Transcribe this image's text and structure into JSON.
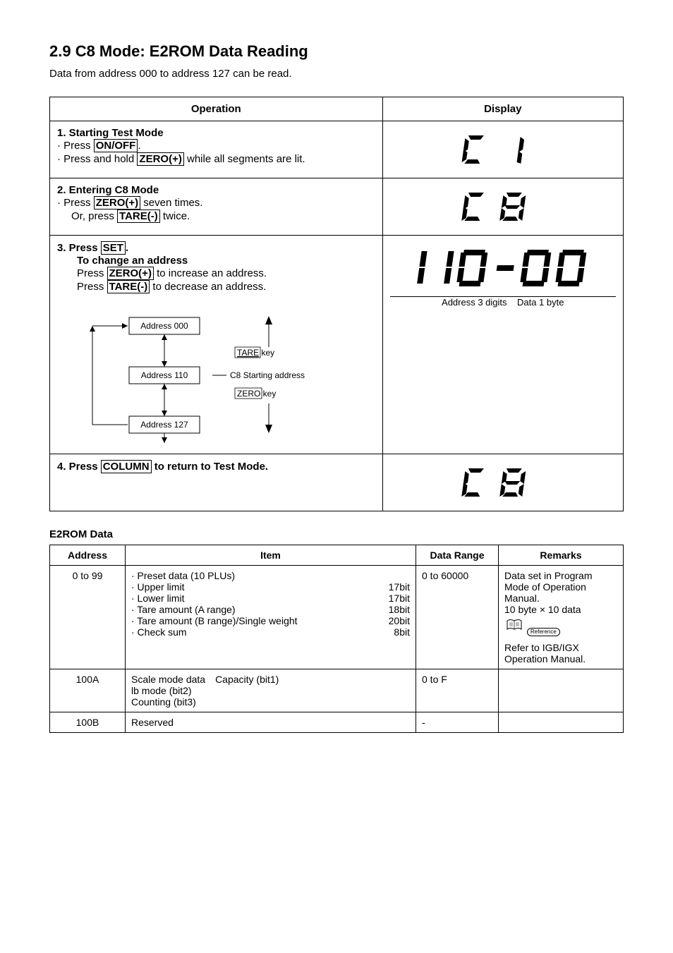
{
  "heading": "2.9   C8 Mode: E2ROM Data Reading",
  "intro": "Data from address 000 to address 127 can be read.",
  "table1": {
    "headers": {
      "operation": "Operation",
      "display": "Display"
    },
    "row1": {
      "title": "1.  Starting Test Mode",
      "line1a": "· Press ",
      "btn1": "ON/OFF",
      "line1b": ".",
      "line2a": "· Press and hold ",
      "btn2": "ZERO(+)",
      "line2b": " while all segments are lit.",
      "display_seg": "C1"
    },
    "row2": {
      "title": "2.  Entering C8 Mode",
      "line1a": "· Press ",
      "btn1": "ZERO(+)",
      "line1b": " seven times.",
      "line2a": "Or, press ",
      "btn2": "TARE(-)",
      "line2b": " twice.",
      "display_seg": "C8"
    },
    "row3": {
      "title_a": "3.  Press ",
      "btn_set": "SET",
      "title_b": ".",
      "sub_title": "To change an address",
      "line1a": "Press ",
      "btn1": "ZERO(+)",
      "line1b": " to increase an address.",
      "line2a": "Press ",
      "btn2": "TARE(-)",
      "line2b": " to decrease an address.",
      "diagram": {
        "addr000": "Address 000",
        "addr110": "Address 110",
        "addr127": "Address 127",
        "tare_key_pre": "TARE",
        "tare_key_post": " key",
        "c8start": "C8 Starting address",
        "zero_key_pre": "ZERO",
        "zero_key_post": " key"
      },
      "display_seg": "110-00",
      "caption_left": "Address 3 digits",
      "caption_right": "Data 1 byte"
    },
    "row4": {
      "title_a": "4.  Press ",
      "btn": "COLUMN",
      "title_b": " to return to Test Mode.",
      "display_seg": "C8"
    }
  },
  "data_section": {
    "title": "E2ROM Data",
    "headers": {
      "address": "Address",
      "item": "Item",
      "range": "Data Range",
      "remarks": "Remarks"
    },
    "rows": [
      {
        "address": "0 to 99",
        "items": [
          {
            "label": "· Preset data (10 PLUs)",
            "bits": ""
          },
          {
            "label": "· Upper limit",
            "bits": "17bit"
          },
          {
            "label": "· Lower limit",
            "bits": "17bit"
          },
          {
            "label": "· Tare amount (A range)",
            "bits": "18bit"
          },
          {
            "label": "· Tare amount (B range)/Single weight",
            "bits": "20bit"
          },
          {
            "label": "· Check sum",
            "bits": "8bit"
          }
        ],
        "range": "0 to 60000",
        "remarks_lines": [
          "Data set in Program Mode of Operation Manual.",
          "10 byte × 10 data"
        ],
        "ref_icon_text": "Reference",
        "remarks_after": "Refer to IGB/IGX Operation Manual."
      },
      {
        "address": "100A",
        "item_plain": "Scale mode data Capacity (bit1)\nlb mode (bit2)\nCounting (bit3)",
        "range": "0 to F",
        "remarks_plain": ""
      },
      {
        "address": "100B",
        "item_plain": "Reserved",
        "range": "-",
        "remarks_plain": ""
      }
    ]
  },
  "chart_data": {
    "type": "table",
    "title": "E2ROM Data",
    "columns": [
      "Address",
      "Item",
      "Data Range",
      "Remarks"
    ],
    "rows": [
      [
        "0 to 99",
        "Preset data (10 PLUs); Upper limit 17bit; Lower limit 17bit; Tare amount (A range) 18bit; Tare amount (B range)/Single weight 20bit; Check sum 8bit",
        "0 to 60000",
        "Data set in Program Mode of Operation Manual. 10 byte × 10 data. Refer to IGB/IGX Operation Manual."
      ],
      [
        "100A",
        "Scale mode data: Capacity (bit1), lb mode (bit2), Counting (bit3)",
        "0 to F",
        ""
      ],
      [
        "100B",
        "Reserved",
        "-",
        ""
      ]
    ]
  }
}
